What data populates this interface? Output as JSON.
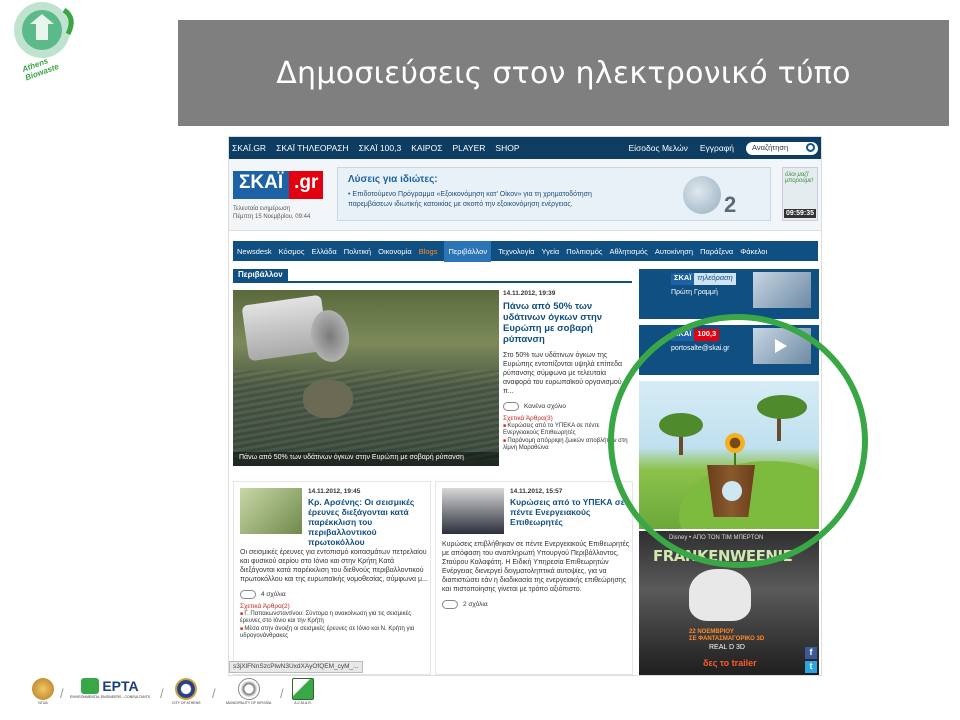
{
  "logo": {
    "text": "Athens Biowaste",
    "color": "#3aa747"
  },
  "slide_title": "Δημοσιεύσεις στον ηλεκτρονικό τύπο",
  "topnav": {
    "items": [
      "ΣΚΑΪ.GR",
      "ΣΚΑΪ ΤΗΛΕΟΡΑΣΗ",
      "ΣΚΑΪ 100,3",
      "ΚΑΙΡΟΣ",
      "PLAYER",
      "SHOP"
    ],
    "login": "Είσοδος Μελών",
    "register": "Εγγραφή",
    "search_placeholder": "Αναζήτηση"
  },
  "brand": {
    "logo_part1": "ΣΚΑΪ",
    "logo_part2": ".gr",
    "updated_label": "Τελευταία ενημέρωση",
    "updated_value": "Πέμπτη 15 Νοεμβρίου, 09:44"
  },
  "ad": {
    "headline": "Λύσεις για ιδιώτες:",
    "body": "• Επιδοτούμενο Πρόγραμμα «Εξοικονόμηση κατ' Οίκον» για τη χρηματοδότηση παρεμβάσεων ιδιωτικής κατοικίας με σκοπό την εξοικονόμηση ενέργειας.",
    "number": "2"
  },
  "clock": {
    "text": "όλοι μαζί μπορούμε!",
    "time": "09:59:35"
  },
  "categories": [
    "Newsdesk",
    "Κόσμος",
    "Ελλάδα",
    "Πολιτική",
    "Οικονομία",
    "Blogs",
    "Περιβάλλον",
    "Τεχνολογία",
    "Υγεία",
    "Πολιτισμός",
    "Αθλητισμός",
    "Αυτοκίνηση",
    "Παράξενα",
    "Φάκελοι"
  ],
  "section": "Περιβάλλον",
  "featured": {
    "caption": "Πάνω από 50% των υδάτινων όγκων στην Ευρώπη με σοβαρή ρύπανση",
    "date": "14.11.2012, 19:39",
    "headline": "Πάνω από 50% των υδάτινων όγκων στην Ευρώπη με σοβαρή ρύπανση",
    "summary": "Στο 50% των υδάτινων όγκων της Ευρώπης εντοπίζονται υψηλά επίπεδα ρύπανσης σύμφωνα με τελευταία αναφορά του ευρωπαϊκού οργανισμού π...",
    "comments": "Κανένα σχόλιο",
    "related_label": "Σχετικά Άρθρα(3)",
    "related": [
      "Κυρώσεις από το ΥΠΕΚΑ σε πέντε Ενεργειακούς Επιθεωρητές",
      "Παράνομη απόρριψη ζωικών αποβλήτων στη λίμνη Μαραθώνα"
    ]
  },
  "article1": {
    "date": "14.11.2012, 19:45",
    "headline": "Κρ. Αρσένης: Οι σεισμικές έρευνες διεξάγονται κατά παρέκκλιση του περιβαλλοντικού πρωτοκόλλου",
    "summary": "Οι σεισμικές έρευνες για εντοπισμό κοιτασμάτων πετρελαίου και φυσικού αερίου στο Ιόνιο και στην Κρήτη Κατά διεξάγονται κατά παρέκκλιση του διεθνούς περιβαλλοντικού πρωτοκόλλου και της ευρωπαϊκής νομοθεσίας, σύμφωνα μ...",
    "comments": "4 σχόλια",
    "related_label": "Σχετικά Άρθρα(2)",
    "related": [
      "Γ. Παπακωνσταντίνου: Σύντομα η ανακοίνωση για τις σεισμικές έρευνες στο Ιόνιο και την Κρήτη",
      "Μέσα στην άνοιξη οι σεισμικές έρευνες σε Ιόνιο και Ν. Κρήτη για υδρογονάνθρακες"
    ]
  },
  "article2": {
    "date": "14.11.2012, 15:57",
    "headline": "Κυρώσεις από το ΥΠΕΚΑ σε πέντε Ενεργειακούς Επιθεωρητές",
    "summary": "Κυρώσεις επιβλήθηκαν σε πέντε Ενεργειακούς Επιθεωρητές με απόφαση του αναπληρωτή Υπουργού Περιβάλλοντος, Σταύρου Καλαφάτη. Η Ειδική Υπηρεσία Επιθεωρητών Ενέργειας διενεργεί δειγματοληπτικά αυτοψίες, για να διαπιστώσει εάν η διαδικασία της ενεργειακής επιθεώρησης και πιστοποίησης γίνεται με τρόπο αξιόπιστο.",
    "comments": "2 σχόλια"
  },
  "url_fragment": "s3jXlFNnSzcPlwN3UxdXAyOfQEM_cyM_...",
  "sidebar": {
    "tv_label_k": "ΣΚΑΪ",
    "tv_label_t": "τηλεόραση",
    "tv_sub": "Πρώτη Γραμμή",
    "radio_label_k": "ΣΚΑΪ",
    "radio_label_r": "100,3",
    "radio_sub": "portosalte@skai.gr"
  },
  "movie": {
    "studio": "Disney • ΑΠΟ ΤΟΝ ΤΙΜ ΜΠΕΡΤΟΝ",
    "title": "FRANKENWEENIE",
    "date_line1": "22 ΝΟΕΜΒΡΙΟΥ",
    "date_line2": "ΣΕ ΦΑΝΤΑΣΜΑΓΟΡΙΚΟ 3D",
    "format": "REAL D 3D",
    "cta": "δες το trailer"
  },
  "footer_logos": [
    {
      "name": "NTUA",
      "caption": "NTUA"
    },
    {
      "name": "EPTA",
      "caption": "ENVIRONMENTAL ENGINEERS - CONSULTANTS"
    },
    {
      "name": "City of Athens",
      "caption": "CITY OF ATHENS"
    },
    {
      "name": "Municipality of Kifissia",
      "caption": "MUNICIPALITY OF KIFISSIA"
    },
    {
      "name": "ACMAR",
      "caption": "A.C.M.A.R."
    }
  ],
  "footer_epta_text": "ΕΡΤΑ",
  "colors": {
    "skai_blue": "#0f4f82",
    "skai_red": "#e3000f",
    "highlight_green": "#3aa747",
    "banner_gray": "#7f7f7f"
  }
}
